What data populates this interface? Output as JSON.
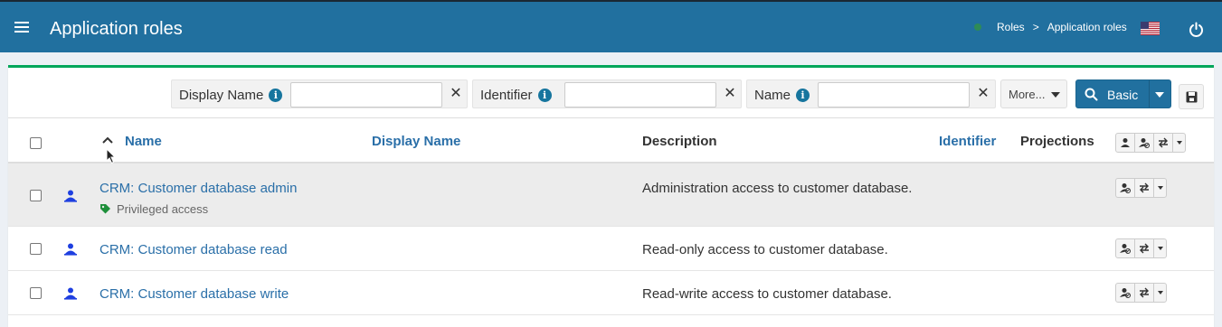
{
  "header": {
    "title": "Application roles",
    "breadcrumb": [
      "Roles",
      "Application roles"
    ],
    "breadcrumb_separator": ">",
    "language_flag": "us-flag-icon",
    "colors": {
      "bar": "#21709f",
      "accent": "#00a65a"
    }
  },
  "search": {
    "fields": [
      {
        "label": "Display Name",
        "value": ""
      },
      {
        "label": "Identifier",
        "value": ""
      },
      {
        "label": "Name",
        "value": ""
      }
    ],
    "more_label": "More...",
    "basic_label": "Basic"
  },
  "table": {
    "columns": {
      "name": "Name",
      "display_name": "Display Name",
      "description": "Description",
      "identifier": "Identifier",
      "projections": "Projections"
    },
    "sort": {
      "column": "Name",
      "direction": "ascending"
    },
    "rows": [
      {
        "name": "CRM: Customer database admin",
        "description": "Administration access to customer database.",
        "tag": "Privileged access",
        "highlighted": true
      },
      {
        "name": "CRM: Customer database read",
        "description": "Read-only access to customer database.",
        "tag": "",
        "highlighted": false
      },
      {
        "name": "CRM: Customer database write",
        "description": "Read-write access to customer database.",
        "tag": "",
        "highlighted": false
      }
    ]
  }
}
